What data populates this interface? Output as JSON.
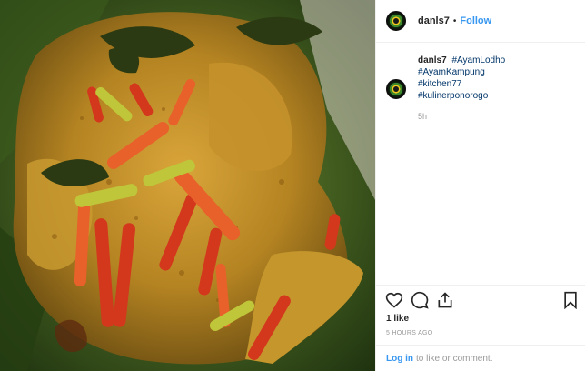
{
  "post": {
    "username": "danls7",
    "separator": "•",
    "follow_label": "Follow"
  },
  "caption": {
    "username": "danls7",
    "hashtags": [
      "#AyamLodho",
      "#AyamKampung",
      "#kitchen77",
      "#kulinerponorogo"
    ],
    "posted": "5h"
  },
  "actions": {
    "icons": [
      "heart-icon",
      "comment-icon",
      "share-icon",
      "bookmark-icon"
    ],
    "likes": "1 like",
    "timestamp": "5 HOURS AGO"
  },
  "comment": {
    "login_label": "Log in",
    "prompt": "to like or comment."
  },
  "colors": {
    "link_blue": "#3897f0",
    "hashtag_blue": "#003569",
    "muted": "#999999",
    "divider": "#efefef"
  }
}
